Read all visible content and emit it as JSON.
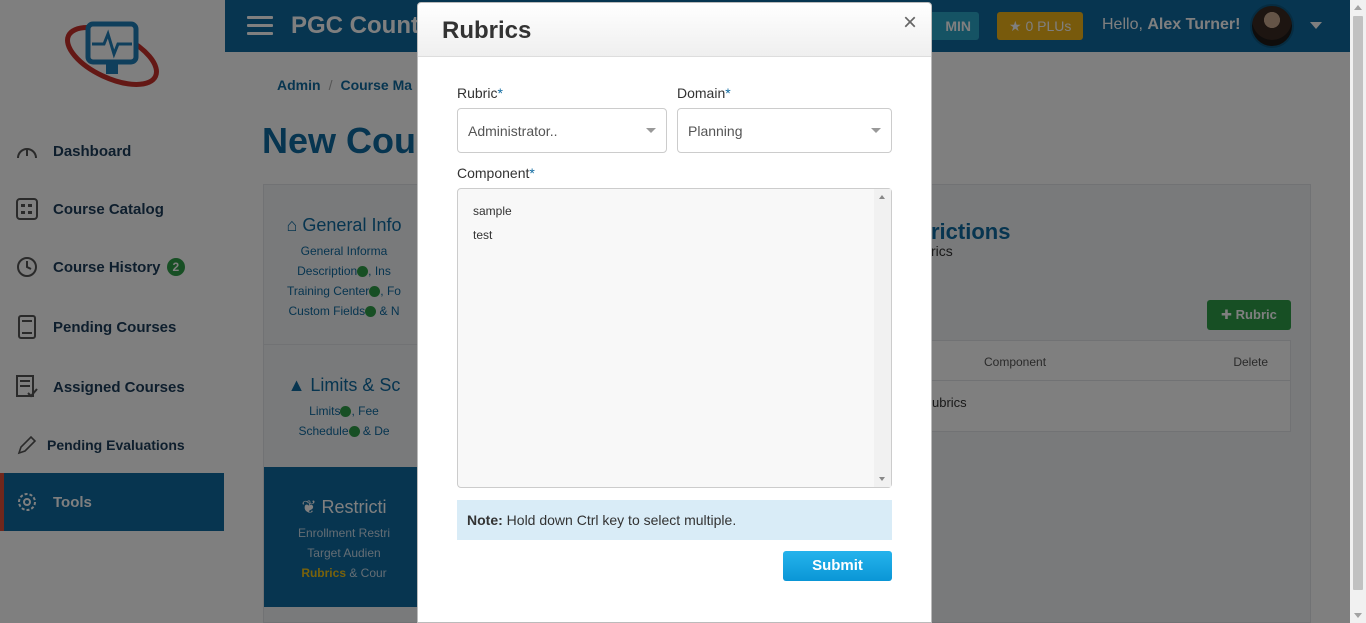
{
  "app": {
    "title": "PGC County",
    "admin_label": "MIN",
    "plu_label": "★ 0 PLUs",
    "hello_prefix": "Hello,",
    "user_name": "Alex Turner!"
  },
  "sidebar": {
    "items": [
      {
        "label": "Dashboard",
        "icon": "gauge-icon"
      },
      {
        "label": "Course Catalog",
        "icon": "catalog-icon"
      },
      {
        "label": "Course History",
        "icon": "history-icon",
        "badge": "2"
      },
      {
        "label": "Pending Courses",
        "icon": "book-icon"
      },
      {
        "label": "Assigned Courses",
        "icon": "checklist-icon"
      },
      {
        "label": "Pending Evaluations",
        "icon": "pencil-icon"
      },
      {
        "label": "Tools",
        "icon": "gear-icon",
        "active": true
      }
    ]
  },
  "breadcrumb": {
    "item1": "Admin",
    "sep": "/",
    "item2": "Course Ma"
  },
  "page": {
    "heading": "New Cour"
  },
  "steps": {
    "s1": {
      "title": "General Info",
      "l1": "General Informa",
      "l2a": "Description",
      "l2b": ", Ins",
      "l3a": "Training Center",
      "l3b": ", Fo",
      "l4a": "Custom Fields",
      "l4b": " & N"
    },
    "s2": {
      "title": "Limits & Sc",
      "l1a": "Limits",
      "l1b": ", Fee",
      "l2a": "Schedule",
      "l2b": " & De"
    },
    "s3": {
      "title": "Restricti",
      "l1": "Enrollment Restri",
      "l2": "Target Audien",
      "l3a": "Rubrics",
      "l3b": " & Cour"
    }
  },
  "restrictions": {
    "title": "rictions",
    "subtitle": "rics",
    "add_button": "Rubric",
    "table": {
      "col_component": "Component",
      "col_delete": "Delete",
      "row_text": "ubrics"
    }
  },
  "modal": {
    "title": "Rubrics",
    "close": "×",
    "rubric_label": "Rubric",
    "rubric_value": "Administrator..",
    "domain_label": "Domain",
    "domain_value": "Planning",
    "component_label": "Component",
    "required_mark": "*",
    "component_options": [
      "sample",
      "test"
    ],
    "note_bold": "Note:",
    "note_text": " Hold down Ctrl key to select multiple.",
    "submit_label": "Submit"
  },
  "colors": {
    "brand": "#0f6aa0",
    "success": "#2e9e48",
    "warning": "#f0b419",
    "submit": "#12a3e0"
  }
}
